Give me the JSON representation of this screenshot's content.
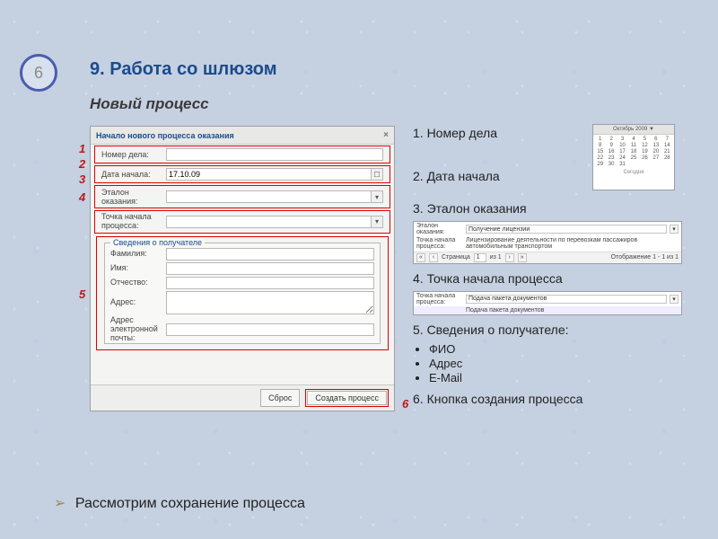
{
  "page_number": "6",
  "title": "9. Работа со шлюзом",
  "subtitle": "Новый процесс",
  "callout_numbers": [
    "1",
    "2",
    "3",
    "4",
    "5",
    "6"
  ],
  "dialog": {
    "title": "Начало нового процесса оказания",
    "close": "×",
    "rows": {
      "case_no_label": "Номер дела:",
      "case_no_value": "",
      "start_date_label": "Дата начала:",
      "start_date_value": "17.10.09",
      "etalon_label": "Эталон оказания:",
      "etalon_value": "",
      "start_point_label": "Точка начала процесса:",
      "start_point_value": ""
    },
    "fieldset_title": "Сведения о получателе",
    "recipient": {
      "lastname_label": "Фамилия:",
      "lastname_value": "",
      "firstname_label": "Имя:",
      "firstname_value": "",
      "patronymic_label": "Отчество:",
      "patronymic_value": "",
      "address_label": "Адрес:",
      "address_value": "",
      "email_label": "Адрес электронной почты:",
      "email_value": ""
    },
    "btn_reset": "Сброс",
    "btn_create": "Создать процесс"
  },
  "right": {
    "i1": "1. Номер дела",
    "i2": "2. Дата начала",
    "i3": "3. Эталон оказания",
    "i4": "4. Точка начала процесса",
    "i5": "5. Сведения о получателе:",
    "i5a": "ФИО",
    "i5b": "Адрес",
    "i5c": "E-Mail",
    "i6": "6. Кнопка создания процесса"
  },
  "calendar": {
    "header": "Октябрь 2009 ▼",
    "days": [
      "1",
      "2",
      "3",
      "4",
      "5",
      "6",
      "7",
      "8",
      "9",
      "10",
      "11",
      "12",
      "13",
      "14",
      "15",
      "16",
      "17",
      "18",
      "19",
      "20",
      "21",
      "22",
      "23",
      "24",
      "25",
      "26",
      "27",
      "28",
      "29",
      "30",
      "31"
    ],
    "footer": "Сегодня"
  },
  "mini1": {
    "etalon_label": "Эталон оказания:",
    "etalon_value": "Получение лицензии",
    "point_label": "Точка начала процесса:",
    "desc": "Лицензирование деятельности по перевозкам пассажиров автомобильным транспортом",
    "page_label": "Страница",
    "page_value": "1",
    "page_total_label": "из 1",
    "display": "Отображение 1 - 1 из 1"
  },
  "mini2": {
    "point_label": "Точка начала процесса:",
    "point_value": "Подача пакета документов",
    "row2": "Подача пакета документов"
  },
  "bottom": "Рассмотрим сохранение процесса"
}
